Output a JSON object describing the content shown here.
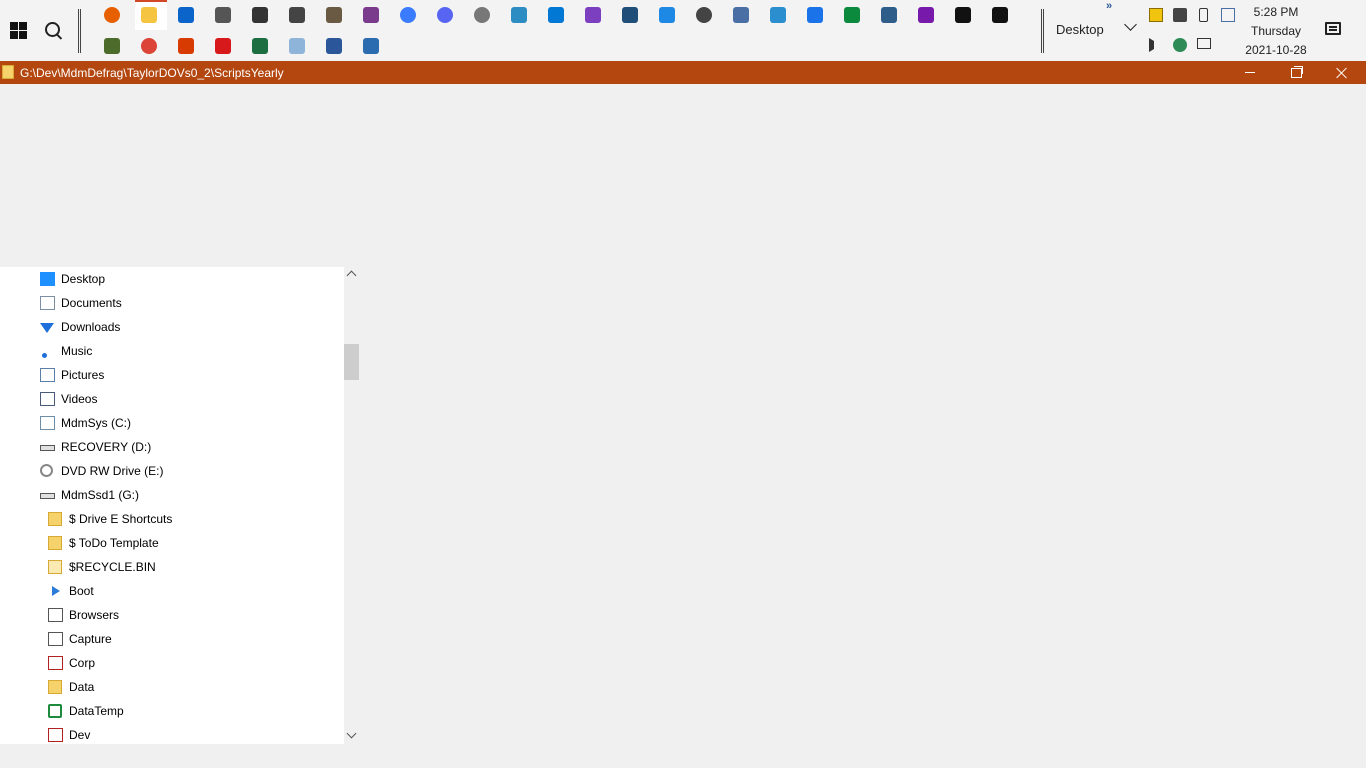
{
  "taskbar": {
    "pinned_top": [
      {
        "name": "firefox-icon",
        "color": "#e66000",
        "round": true
      },
      {
        "name": "file-explorer-icon",
        "color": "#f5c542"
      },
      {
        "name": "outlook-icon",
        "color": "#0a64c9"
      },
      {
        "name": "satellite-icon",
        "color": "#555555"
      },
      {
        "name": "scanner-icon",
        "color": "#333333"
      },
      {
        "name": "camera-icon",
        "color": "#444444"
      },
      {
        "name": "gimp-icon",
        "color": "#6b5a43"
      },
      {
        "name": "winrar-icon",
        "color": "#7a3b8c"
      },
      {
        "name": "messenger-icon",
        "color": "#3b7bff",
        "round": true
      },
      {
        "name": "discord-icon",
        "color": "#5865f2",
        "round": true
      },
      {
        "name": "clock-app-icon",
        "color": "#777777",
        "round": true
      },
      {
        "name": "paint-icon",
        "color": "#2d8cc2"
      },
      {
        "name": "vscode-icon",
        "color": "#0078d4"
      },
      {
        "name": "visual-studio-icon",
        "color": "#7b3fbf"
      },
      {
        "name": "journal-icon",
        "color": "#1f4e79"
      },
      {
        "name": "tiles-icon",
        "color": "#1e88e5"
      },
      {
        "name": "settings-gear-icon",
        "color": "#444444",
        "round": true
      },
      {
        "name": "network-icon",
        "color": "#4a6fa5"
      },
      {
        "name": "display-icon",
        "color": "#2b8fcf"
      },
      {
        "name": "todo-check-icon",
        "color": "#1a73e8"
      },
      {
        "name": "money-icon",
        "color": "#0b8a3e"
      },
      {
        "name": "remote-desktop-icon",
        "color": "#2f5d8a"
      },
      {
        "name": "onenote-icon",
        "color": "#7719aa"
      },
      {
        "name": "cmd-icon",
        "color": "#111111"
      },
      {
        "name": "cmd-admin-icon",
        "color": "#111111"
      }
    ],
    "pinned_bottom": [
      {
        "name": "palm-tree-icon",
        "color": "#4d6b2a"
      },
      {
        "name": "chrome-icon",
        "color": "#db4437",
        "round": true
      },
      {
        "name": "office-icon",
        "color": "#d83b01"
      },
      {
        "name": "acrobat-icon",
        "color": "#d7191c"
      },
      {
        "name": "excel-icon",
        "color": "#1d6f42"
      },
      {
        "name": "notepad-icon",
        "color": "#8fb4d9"
      },
      {
        "name": "word-icon",
        "color": "#2b579a"
      },
      {
        "name": "document-icon",
        "color": "#2b6cb0"
      }
    ],
    "desktop_toolbar": "Desktop",
    "overflow": "»",
    "clock": {
      "time": "5:28 PM",
      "day": "Thursday",
      "date": "2021-10-28"
    }
  },
  "window": {
    "title": "G:\\Dev\\MdmDefrag\\TaylorDOVs0_2\\ScriptsYearly",
    "accent": "#b3470f"
  },
  "nav": {
    "items": [
      {
        "label": "Desktop",
        "icon": "desktop-icon",
        "color": "#1e90ff",
        "indent": 0
      },
      {
        "label": "Documents",
        "icon": "documents-icon",
        "color": "#7d8fa3",
        "indent": 0
      },
      {
        "label": "Downloads",
        "icon": "downloads-arrow-icon",
        "color": "#1e6fd9",
        "indent": 0
      },
      {
        "label": "Music",
        "icon": "music-note-icon",
        "color": "#1e6fd9",
        "indent": 0
      },
      {
        "label": "Pictures",
        "icon": "pictures-icon",
        "color": "#5a7fa8",
        "indent": 0
      },
      {
        "label": "Videos",
        "icon": "videos-film-icon",
        "color": "#4a5a78",
        "indent": 0
      },
      {
        "label": "MdmSys (C:)",
        "icon": "system-drive-icon",
        "color": "#6c8ea8",
        "indent": 0
      },
      {
        "label": "RECOVERY (D:)",
        "icon": "drive-icon",
        "color": "#555555",
        "indent": 0
      },
      {
        "label": "DVD RW Drive (E:)",
        "icon": "dvd-drive-icon",
        "color": "#888888",
        "indent": 0
      },
      {
        "label": "MdmSsd1 (G:)",
        "icon": "drive-icon",
        "color": "#555555",
        "indent": 0
      },
      {
        "label": "$ Drive E Shortcuts",
        "icon": "folder-icon",
        "color": "#f6d36a",
        "indent": 1
      },
      {
        "label": "$ ToDo Template",
        "icon": "folder-icon",
        "color": "#f6d36a",
        "indent": 1
      },
      {
        "label": "$RECYCLE.BIN",
        "icon": "folder-faded-icon",
        "color": "#fbeab2",
        "indent": 1
      },
      {
        "label": "Boot",
        "icon": "boot-arrow-icon",
        "color": "#2b7bd8",
        "indent": 1
      },
      {
        "label": "Browsers",
        "icon": "browsers-icon",
        "color": "#555555",
        "indent": 1
      },
      {
        "label": "Capture",
        "icon": "camera-icon",
        "color": "#555555",
        "indent": 1
      },
      {
        "label": "Corp",
        "icon": "corp-icon",
        "color": "#b22222",
        "indent": 1
      },
      {
        "label": "Data",
        "icon": "folder-icon",
        "color": "#f6d36a",
        "indent": 1
      },
      {
        "label": "DataTemp",
        "icon": "datatemp-arrow-icon",
        "color": "#1e8a3c",
        "indent": 1
      },
      {
        "label": "Dev",
        "icon": "dev-icon",
        "color": "#b22222",
        "indent": 1
      }
    ]
  }
}
